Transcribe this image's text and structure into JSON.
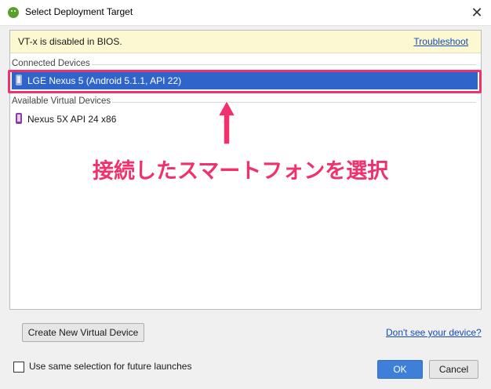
{
  "window": {
    "title": "Select Deployment Target",
    "close_glyph": "✕"
  },
  "warning": {
    "text": "VT-x is disabled in BIOS.",
    "link": "Troubleshoot"
  },
  "groups": {
    "connected": {
      "label": "Connected Devices",
      "devices": [
        {
          "name": "LGE Nexus 5 (Android 5.1.1, API 22)",
          "icon": "phone-icon",
          "selected": true
        }
      ]
    },
    "virtual": {
      "label": "Available Virtual Devices",
      "devices": [
        {
          "name": "Nexus 5X API 24 x86",
          "icon": "phone-icon",
          "selected": false
        }
      ]
    }
  },
  "annotation": {
    "text": "接続したスマートフォンを選択",
    "color": "#f0316b"
  },
  "buttons": {
    "create": "Create New Virtual Device",
    "dont_see": "Don't see your device?",
    "ok": "OK",
    "cancel": "Cancel"
  },
  "checkbox": {
    "label": "Use same selection for future launches",
    "checked": false
  },
  "colors": {
    "selection": "#2f65ca",
    "primary_button": "#3d7fd9",
    "warning_bg": "#fcf9d2",
    "link": "#1449b8"
  }
}
